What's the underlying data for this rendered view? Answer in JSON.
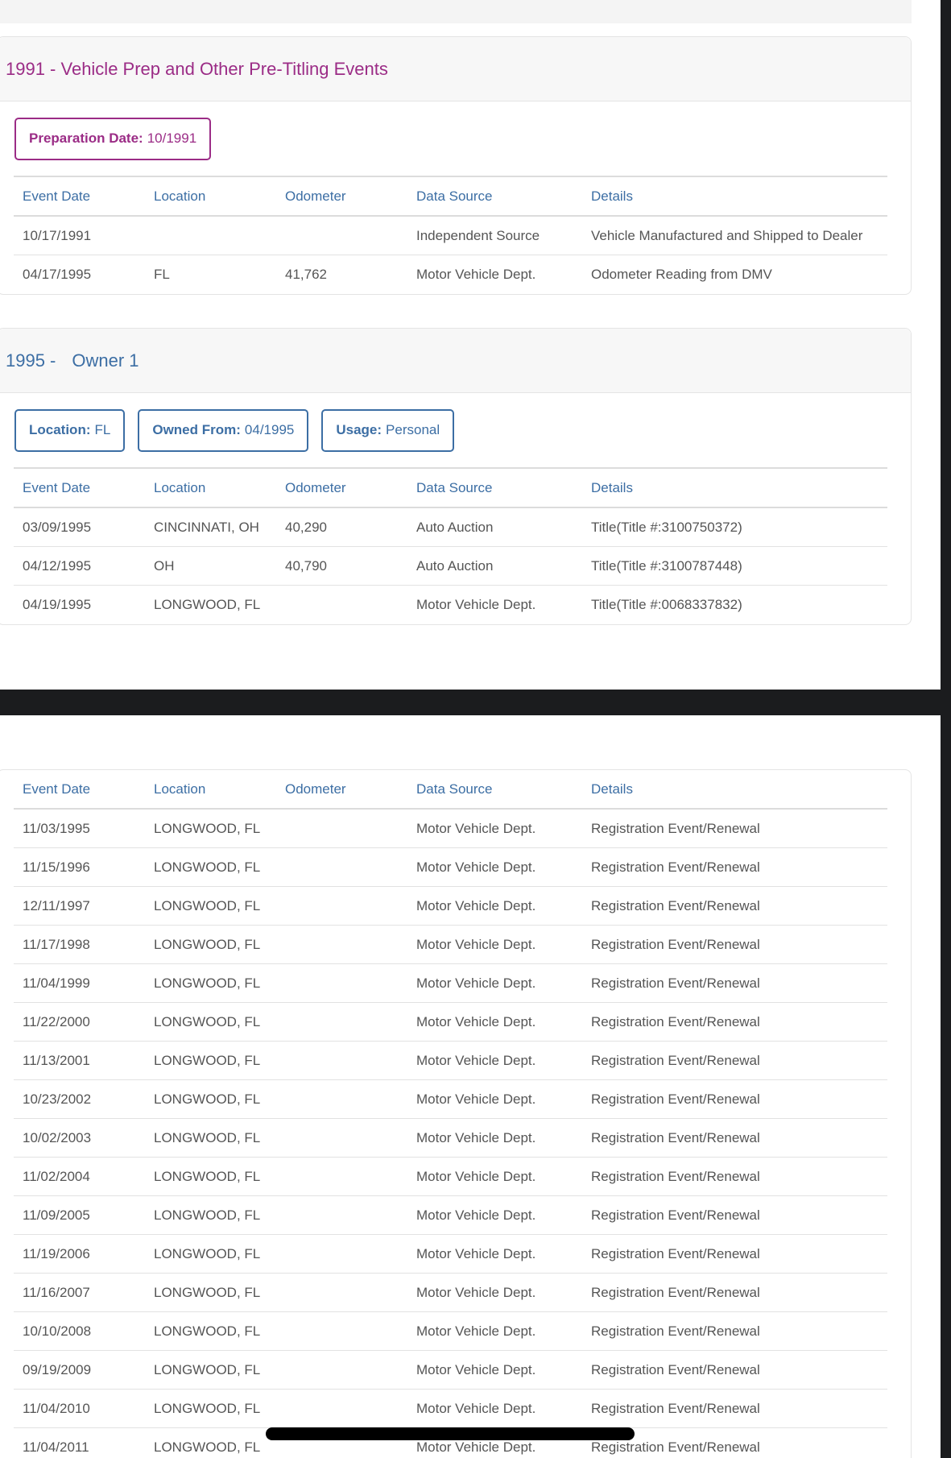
{
  "section_prep": {
    "title": "1991 - Vehicle Prep and Other Pre-Titling Events",
    "pill_label": "Preparation Date:",
    "pill_value": "10/1991",
    "columns": [
      "Event Date",
      "Location",
      "Odometer",
      "Data Source",
      "Details"
    ],
    "rows": [
      [
        "10/17/1991",
        "",
        "",
        "Independent Source",
        "Vehicle Manufactured and Shipped to Dealer"
      ],
      [
        "04/17/1995",
        "FL",
        "41,762",
        "Motor Vehicle Dept.",
        "Odometer Reading from DMV"
      ]
    ]
  },
  "section_owner": {
    "year": "1995 -",
    "owner_label": "Owner 1",
    "pills": [
      {
        "label": "Location:",
        "value": "FL"
      },
      {
        "label": "Owned From:",
        "value": "04/1995"
      },
      {
        "label": "Usage:",
        "value": "Personal"
      }
    ],
    "columns": [
      "Event Date",
      "Location",
      "Odometer",
      "Data Source",
      "Details"
    ],
    "rows": [
      [
        "03/09/1995",
        "CINCINNATI, OH",
        "40,290",
        "Auto Auction",
        "Title(Title #:3100750372)"
      ],
      [
        "04/12/1995",
        "OH",
        "40,790",
        "Auto Auction",
        "Title(Title #:3100787448)"
      ],
      [
        "04/19/1995",
        "LONGWOOD, FL",
        "",
        "Motor Vehicle Dept.",
        "Title(Title #:0068337832)"
      ]
    ]
  },
  "section_continued": {
    "columns": [
      "Event Date",
      "Location",
      "Odometer",
      "Data Source",
      "Details"
    ],
    "rows": [
      [
        "11/03/1995",
        "LONGWOOD, FL",
        "",
        "Motor Vehicle Dept.",
        "Registration Event/Renewal"
      ],
      [
        "11/15/1996",
        "LONGWOOD, FL",
        "",
        "Motor Vehicle Dept.",
        "Registration Event/Renewal"
      ],
      [
        "12/11/1997",
        "LONGWOOD, FL",
        "",
        "Motor Vehicle Dept.",
        "Registration Event/Renewal"
      ],
      [
        "11/17/1998",
        "LONGWOOD, FL",
        "",
        "Motor Vehicle Dept.",
        "Registration Event/Renewal"
      ],
      [
        "11/04/1999",
        "LONGWOOD, FL",
        "",
        "Motor Vehicle Dept.",
        "Registration Event/Renewal"
      ],
      [
        "11/22/2000",
        "LONGWOOD, FL",
        "",
        "Motor Vehicle Dept.",
        "Registration Event/Renewal"
      ],
      [
        "11/13/2001",
        "LONGWOOD, FL",
        "",
        "Motor Vehicle Dept.",
        "Registration Event/Renewal"
      ],
      [
        "10/23/2002",
        "LONGWOOD, FL",
        "",
        "Motor Vehicle Dept.",
        "Registration Event/Renewal"
      ],
      [
        "10/02/2003",
        "LONGWOOD, FL",
        "",
        "Motor Vehicle Dept.",
        "Registration Event/Renewal"
      ],
      [
        "11/02/2004",
        "LONGWOOD, FL",
        "",
        "Motor Vehicle Dept.",
        "Registration Event/Renewal"
      ],
      [
        "11/09/2005",
        "LONGWOOD, FL",
        "",
        "Motor Vehicle Dept.",
        "Registration Event/Renewal"
      ],
      [
        "11/19/2006",
        "LONGWOOD, FL",
        "",
        "Motor Vehicle Dept.",
        "Registration Event/Renewal"
      ],
      [
        "11/16/2007",
        "LONGWOOD, FL",
        "",
        "Motor Vehicle Dept.",
        "Registration Event/Renewal"
      ],
      [
        "10/10/2008",
        "LONGWOOD, FL",
        "",
        "Motor Vehicle Dept.",
        "Registration Event/Renewal"
      ],
      [
        "09/19/2009",
        "LONGWOOD, FL",
        "",
        "Motor Vehicle Dept.",
        "Registration Event/Renewal"
      ],
      [
        "11/04/2010",
        "LONGWOOD, FL",
        "",
        "Motor Vehicle Dept.",
        "Registration Event/Renewal"
      ],
      [
        "11/04/2011",
        "LONGWOOD, FL",
        "",
        "Motor Vehicle Dept.",
        "Registration Event/Renewal"
      ]
    ]
  }
}
